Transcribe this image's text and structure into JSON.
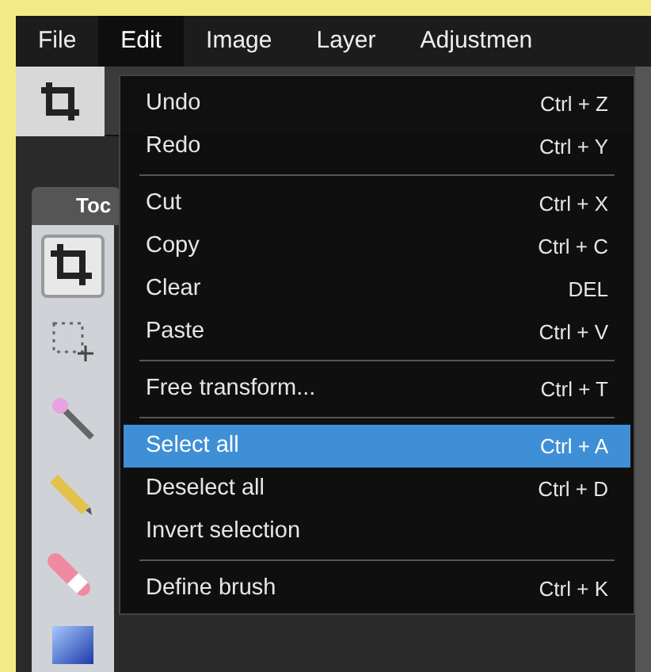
{
  "menu_bar": [
    {
      "label": "File",
      "selected": false
    },
    {
      "label": "Edit",
      "selected": true
    },
    {
      "label": "Image",
      "selected": false
    },
    {
      "label": "Layer",
      "selected": false
    },
    {
      "label": "Adjustmen",
      "selected": false
    }
  ],
  "tools_panel": {
    "title": "Toc",
    "tools": [
      {
        "kind": "crop",
        "selected": true
      },
      {
        "kind": "marquee",
        "selected": false
      },
      {
        "kind": "wand",
        "selected": false
      },
      {
        "kind": "pencil",
        "selected": false
      },
      {
        "kind": "eraser",
        "selected": false
      },
      {
        "kind": "gradient",
        "selected": false
      }
    ]
  },
  "edit_menu": [
    {
      "kind": "item",
      "label": "Undo",
      "shortcut": "Ctrl + Z",
      "selected": false
    },
    {
      "kind": "item",
      "label": "Redo",
      "shortcut": "Ctrl + Y",
      "selected": false
    },
    {
      "kind": "separator"
    },
    {
      "kind": "item",
      "label": "Cut",
      "shortcut": "Ctrl + X",
      "selected": false
    },
    {
      "kind": "item",
      "label": "Copy",
      "shortcut": "Ctrl + C",
      "selected": false
    },
    {
      "kind": "item",
      "label": "Clear",
      "shortcut": "DEL",
      "selected": false
    },
    {
      "kind": "item",
      "label": "Paste",
      "shortcut": "Ctrl + V",
      "selected": false
    },
    {
      "kind": "separator"
    },
    {
      "kind": "item",
      "label": "Free transform...",
      "shortcut": "Ctrl + T",
      "selected": false
    },
    {
      "kind": "separator"
    },
    {
      "kind": "item",
      "label": "Select all",
      "shortcut": "Ctrl + A",
      "selected": true
    },
    {
      "kind": "item",
      "label": "Deselect all",
      "shortcut": "Ctrl + D",
      "selected": false
    },
    {
      "kind": "item",
      "label": "Invert selection",
      "selected": false
    },
    {
      "kind": "separator"
    },
    {
      "kind": "item",
      "label": "Define brush",
      "shortcut": "Ctrl + K",
      "selected": false
    }
  ]
}
